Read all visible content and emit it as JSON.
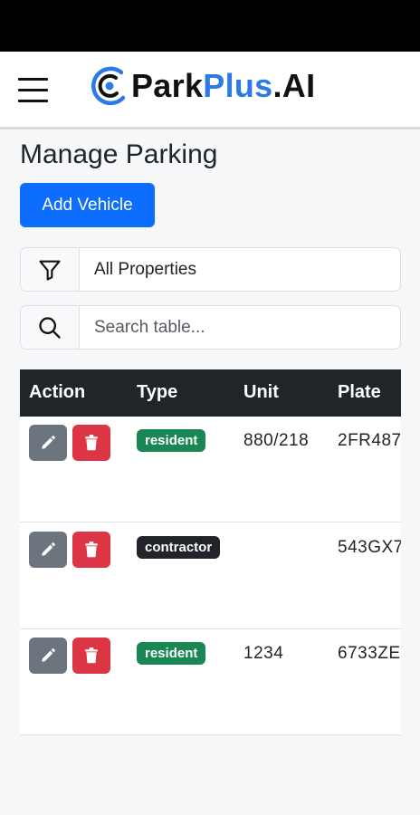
{
  "header": {
    "brand_park": "Park",
    "brand_plus": "Plus",
    "brand_ai": ".AI",
    "menu_icon": "hamburger-menu-icon",
    "logo_icon": "parking-target-icon",
    "colors": {
      "brand_blue": "#2b7ae6",
      "primary": "#0d6efd"
    }
  },
  "page": {
    "title": "Manage Parking",
    "add_button_label": "Add Vehicle"
  },
  "filter": {
    "icon": "filter-funnel-icon",
    "selected_value": "All Properties"
  },
  "search": {
    "icon": "search-icon",
    "placeholder": "Search table..."
  },
  "table": {
    "columns": [
      "Action",
      "Type",
      "Unit",
      "Plate"
    ],
    "rows": [
      {
        "type": "resident",
        "unit": "880/218",
        "plate": "2FR487"
      },
      {
        "type": "contractor",
        "unit": "",
        "plate": "543GX7"
      },
      {
        "type": "resident",
        "unit": "1234",
        "plate": "6733ZE"
      }
    ],
    "edit_icon": "pencil-icon",
    "delete_icon": "trash-icon",
    "colors": {
      "resident": "#198754",
      "contractor": "#212529",
      "edit": "#6c757d",
      "delete": "#dc3545"
    }
  }
}
